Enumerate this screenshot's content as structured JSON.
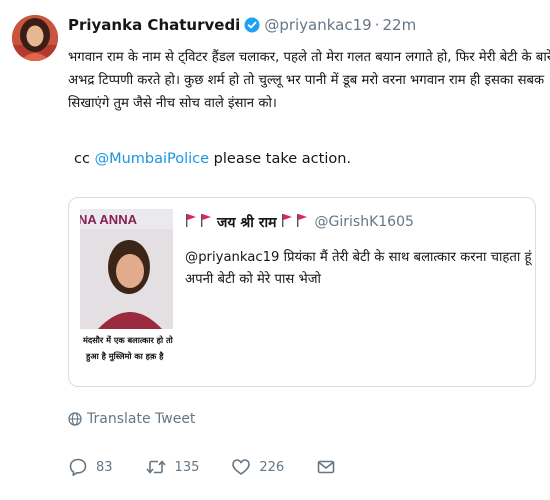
{
  "tweet": {
    "author_name": "Priyanka Chaturvedi",
    "handle": "@priyankac19",
    "separator": "·",
    "time": "22m",
    "text_lines": [
      "भगवान राम के नाम से ट्विटर हैंडल चलाकर, पहले तो मेरा गलत बयान लगाते हो, फिर मेरी बेटी के बारे में",
      "अभद्र टिप्पणी करते हो। कुछ शर्म हो तो चुल्लू भर पानी में डूब मरो वरना भगवान राम ही इसका सबक",
      "सिखाएंगे तुम जैसे नीच सोच वाले इंसान को।"
    ],
    "cc_prefix": "cc ",
    "cc_mention": "@MumbaiPolice",
    "cc_suffix": " please take action."
  },
  "quoted_tweet": {
    "name": "जय श्री राम",
    "handle": "@GirishK1605",
    "text_lines": [
      "@priyankac19 प्रियंका मैं तेरी बेटी के साथ बलात्कार करना चाहता हूं",
      "अपनी बेटी को मेरे पास भेजो"
    ],
    "image": {
      "banner_text": "NA ANNA",
      "caption_lines": [
        "मंदसौर में एक बलात्कार हो तो",
        "हुआ है मुस्लिमो का हक़ है"
      ]
    }
  },
  "translate_label": "Translate Tweet",
  "actions": {
    "replies": "83",
    "retweets": "135",
    "likes": "226"
  },
  "colors": {
    "link": "#1b95e0",
    "secondary": "#657786",
    "flag": "#e0245e"
  },
  "icons": [
    "verified-badge-icon",
    "flag-icon",
    "globe-icon",
    "reply-icon",
    "retweet-icon",
    "like-icon",
    "message-icon"
  ]
}
